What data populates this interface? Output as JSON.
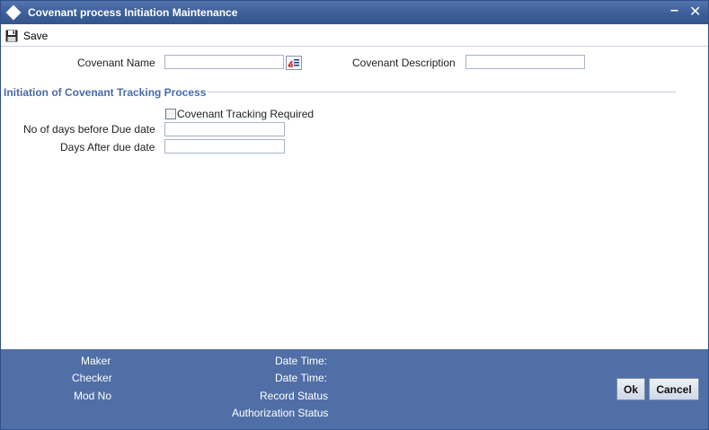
{
  "window": {
    "title": "Covenant process Initiation Maintenance",
    "minimize_glyph": "–",
    "close_glyph": "✕",
    "icon": "diamond-icon"
  },
  "toolbar": {
    "save_label": "Save",
    "save_icon": "floppy-disk-icon"
  },
  "form": {
    "covenant_name_label": "Covenant Name",
    "covenant_name_value": "",
    "lov_icon": "list-of-values-icon",
    "covenant_description_label": "Covenant Description",
    "covenant_description_value": ""
  },
  "section": {
    "title": "Initiation of Covenant Tracking Process",
    "tracking_required_label": "Covenant Tracking Required",
    "tracking_required_checked": false,
    "days_before_label": "No of days before Due date",
    "days_before_value": "",
    "days_after_label": "Days After due date",
    "days_after_value": ""
  },
  "footer": {
    "maker_label": "Maker",
    "checker_label": "Checker",
    "mod_no_label": "Mod No",
    "date_time_label_1": "Date Time:",
    "date_time_label_2": "Date Time:",
    "record_status_label": "Record Status",
    "authorization_status_label": "Authorization Status",
    "ok_label": "Ok",
    "cancel_label": "Cancel"
  },
  "colors": {
    "title_bar": "#3c5e98",
    "footer": "#506fa6",
    "section_title": "#4a6ba8"
  }
}
